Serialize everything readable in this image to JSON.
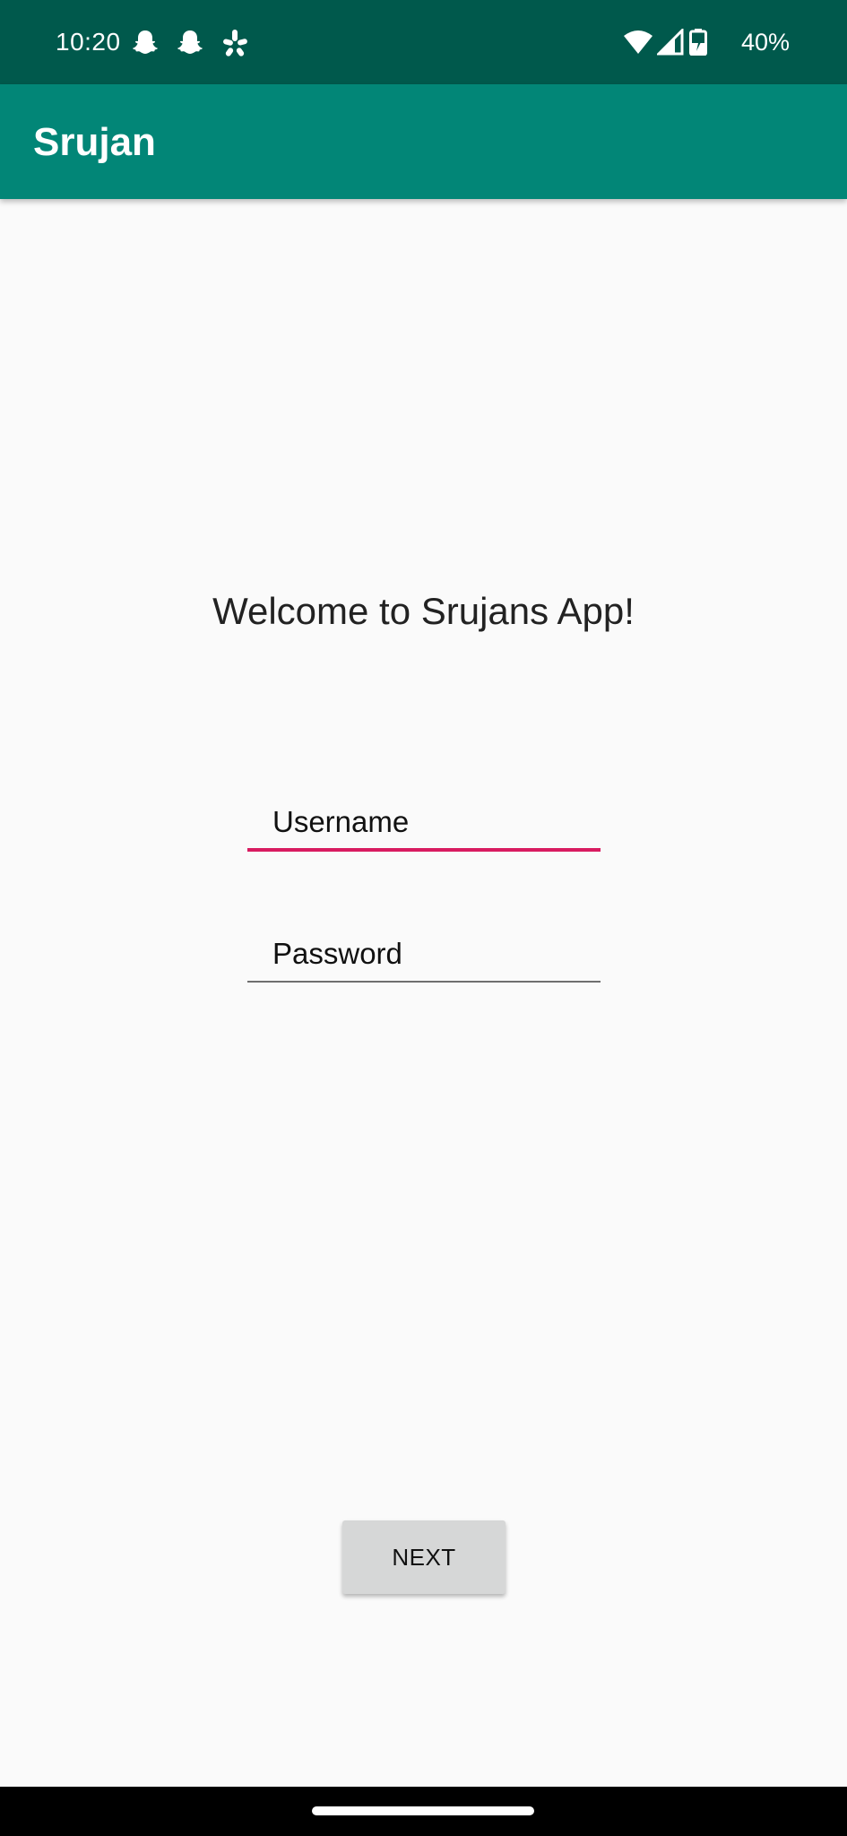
{
  "status_bar": {
    "time": "10:20",
    "notification_icons": [
      "snapchat-ghost-icon",
      "snapchat-ghost-icon",
      "yelp-burst-icon"
    ],
    "system_icons": [
      "wifi-icon",
      "cellular-signal-icon",
      "battery-charging-icon"
    ],
    "battery_percent": "40%"
  },
  "app_bar": {
    "title": "Srujan",
    "color": "#028677"
  },
  "main": {
    "welcome_text": "Welcome to Srujans App!",
    "username": {
      "value": "",
      "placeholder": "Username"
    },
    "password": {
      "value": "",
      "placeholder": "Password"
    },
    "next_label": "NEXT"
  },
  "colors": {
    "status_bar": "#00594c",
    "app_bar": "#028677",
    "focused_underline": "#d81b60",
    "background": "#fafafa",
    "button": "#d6d7d7"
  }
}
